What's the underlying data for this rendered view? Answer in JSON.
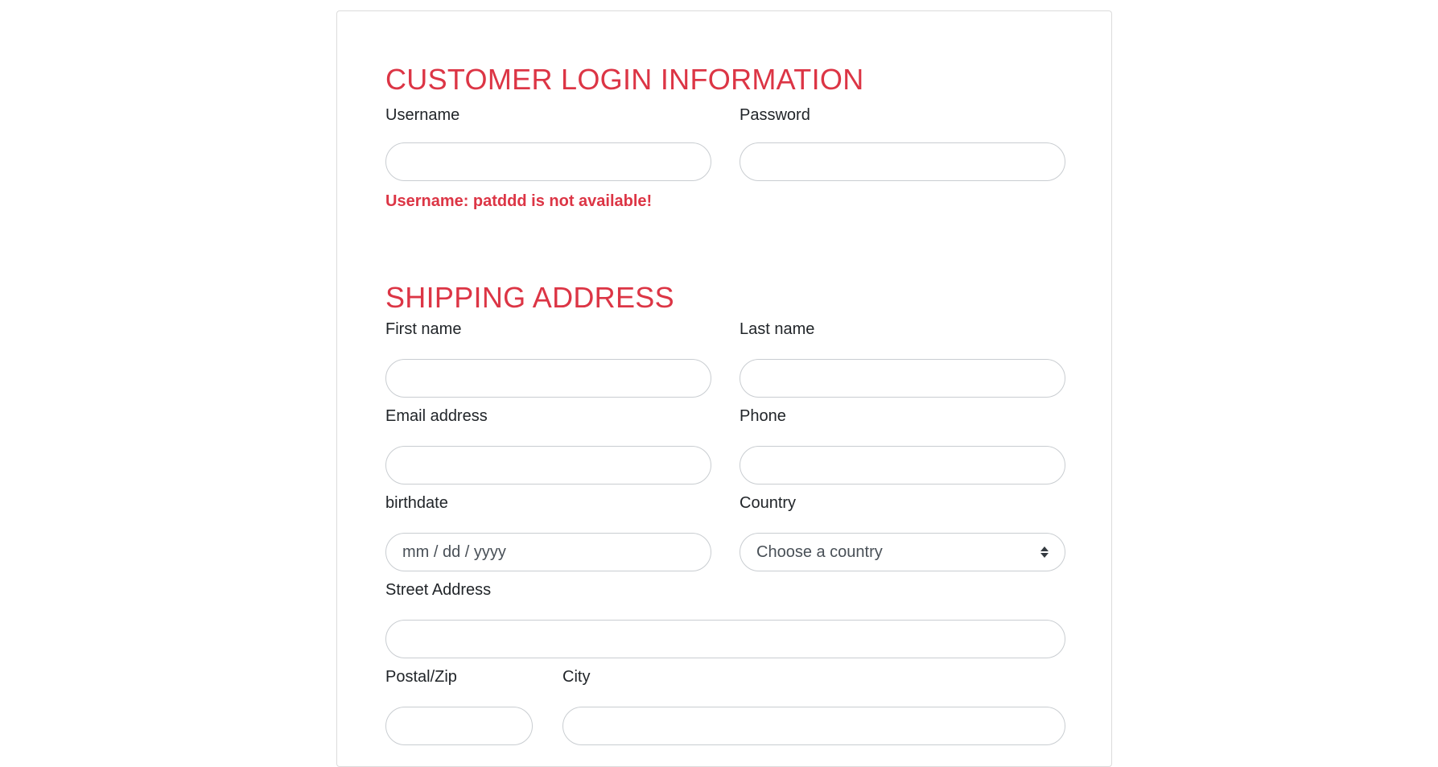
{
  "login": {
    "title": "CUSTOMER LOGIN INFORMATION",
    "username_label": "Username",
    "username_value": "",
    "password_label": "Password",
    "password_value": "",
    "username_error": "Username: patddd is not available!"
  },
  "shipping": {
    "title": "SHIPPING ADDRESS",
    "first_name_label": "First name",
    "last_name_label": "Last name",
    "email_label": "Email address",
    "phone_label": "Phone",
    "birthdate_label": "birthdate",
    "birthdate_placeholder": "mm / dd / yyyy",
    "country_label": "Country",
    "country_selected": "Choose a country",
    "street_label": "Street Address",
    "postal_label": "Postal/Zip",
    "city_label": "City"
  },
  "colors": {
    "accent": "#dc3545",
    "border": "#c9cdd1"
  },
  "icons": {
    "country_select": "sort-arrows-icon"
  }
}
